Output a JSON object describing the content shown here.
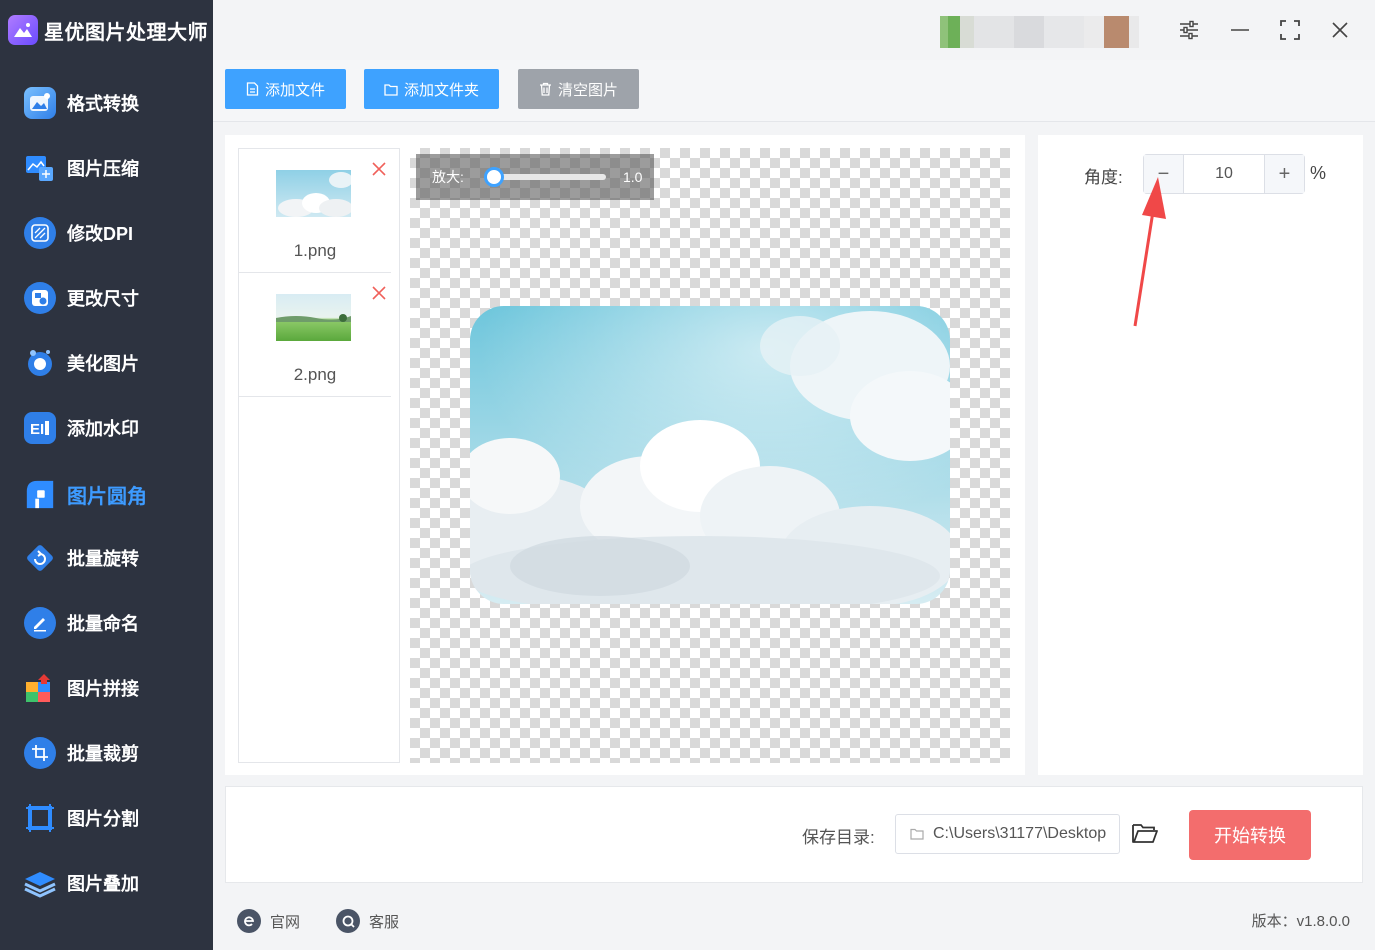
{
  "app": {
    "title": "星优图片处理大师"
  },
  "sidebar": {
    "items": [
      {
        "label": "格式转换",
        "icon": "format-convert-icon"
      },
      {
        "label": "图片压缩",
        "icon": "compress-icon"
      },
      {
        "label": "修改DPI",
        "icon": "dpi-icon"
      },
      {
        "label": "更改尺寸",
        "icon": "resize-icon"
      },
      {
        "label": "美化图片",
        "icon": "beautify-icon"
      },
      {
        "label": "添加水印",
        "icon": "watermark-icon"
      },
      {
        "label": "图片圆角",
        "icon": "round-corner-icon",
        "active": true
      },
      {
        "label": "批量旋转",
        "icon": "rotate-icon"
      },
      {
        "label": "批量命名",
        "icon": "rename-icon"
      },
      {
        "label": "图片拼接",
        "icon": "stitch-icon"
      },
      {
        "label": "批量裁剪",
        "icon": "crop-icon"
      },
      {
        "label": "图片分割",
        "icon": "split-icon"
      },
      {
        "label": "图片叠加",
        "icon": "overlay-icon"
      }
    ]
  },
  "toolbar": {
    "add_file": "添加文件",
    "add_folder": "添加文件夹",
    "clear_images": "清空图片"
  },
  "files": [
    {
      "name": "1.png"
    },
    {
      "name": "2.png"
    }
  ],
  "preview": {
    "zoom_label": "放大:",
    "zoom_value": "1.0"
  },
  "settings": {
    "angle_label": "角度:",
    "angle_value": "10",
    "angle_unit": "%",
    "minus": "−",
    "plus": "+"
  },
  "save": {
    "label": "保存目录:",
    "path": "C:\\Users\\31177\\Desktop",
    "start_button": "开始转换"
  },
  "footer": {
    "website": "官网",
    "support": "客服",
    "version": "版本：v1.8.0.0"
  },
  "colors": {
    "sidebar_bg": "#2d3340",
    "accent_blue": "#3ea2ff",
    "active_nav": "#3d9bff",
    "start_button": "#f36d6d",
    "clear_button": "#9ea3aa"
  }
}
